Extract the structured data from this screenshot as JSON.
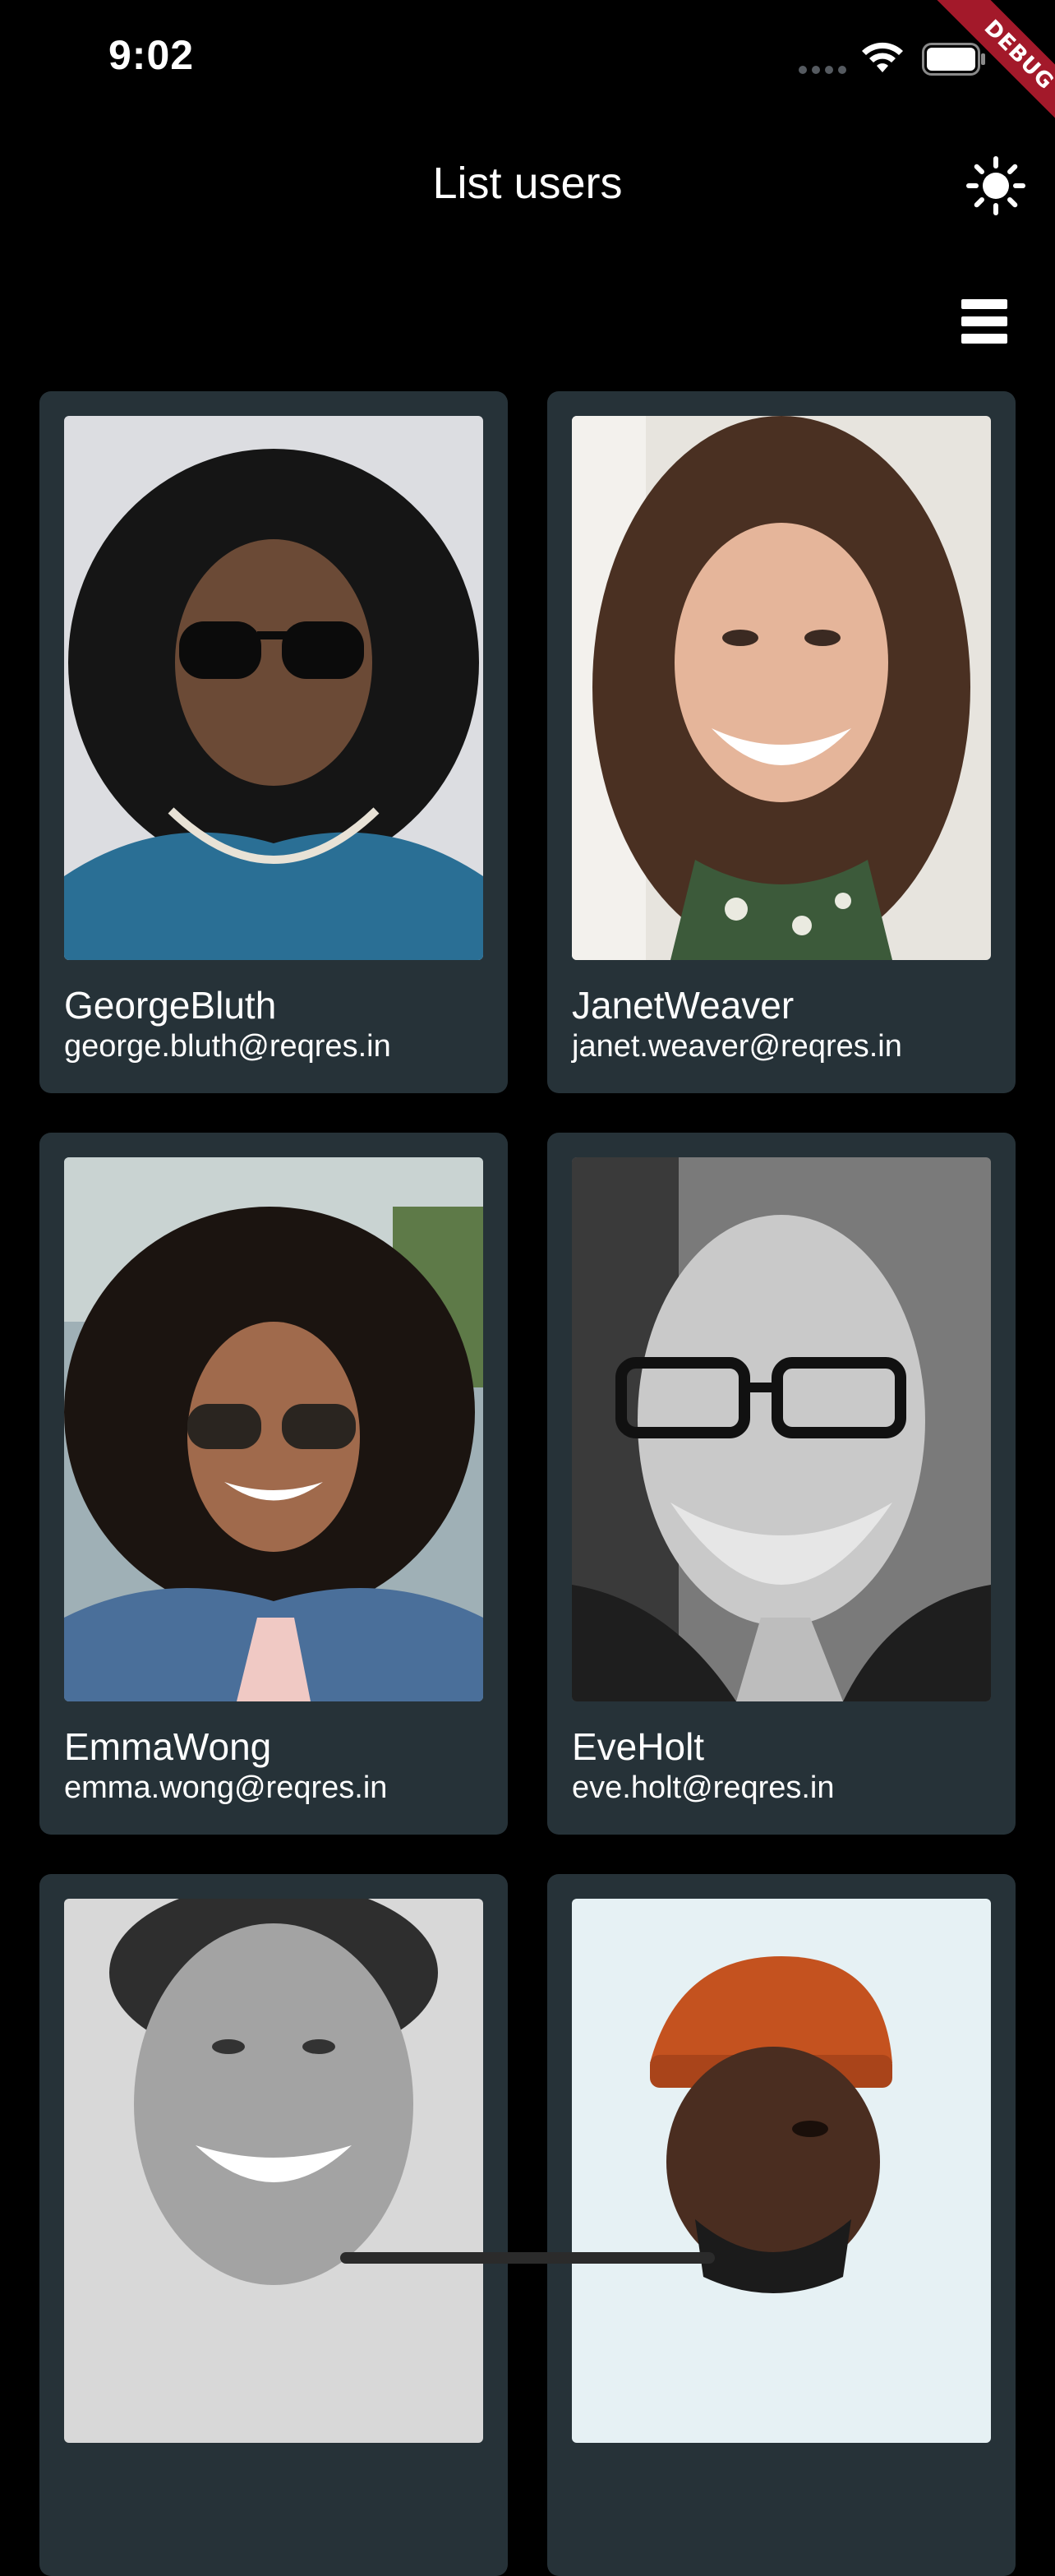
{
  "status_bar": {
    "time": "9:02"
  },
  "debug_banner": {
    "label": "DEBUG"
  },
  "app_bar": {
    "title": "List users",
    "theme_icon": "sun-icon",
    "view_icon": "grid-list-toggle-icon"
  },
  "users": [
    {
      "name": "GeorgeBluth",
      "email": "george.bluth@reqres.in"
    },
    {
      "name": "JanetWeaver",
      "email": "janet.weaver@reqres.in"
    },
    {
      "name": "EmmaWong",
      "email": "emma.wong@reqres.in"
    },
    {
      "name": "EveHolt",
      "email": "eve.holt@reqres.in"
    },
    {
      "name": "",
      "email": ""
    },
    {
      "name": "",
      "email": ""
    }
  ],
  "colors": {
    "background": "#000000",
    "card": "#263238",
    "text": "#ffffff",
    "debug_ribbon": "#a3192a"
  }
}
